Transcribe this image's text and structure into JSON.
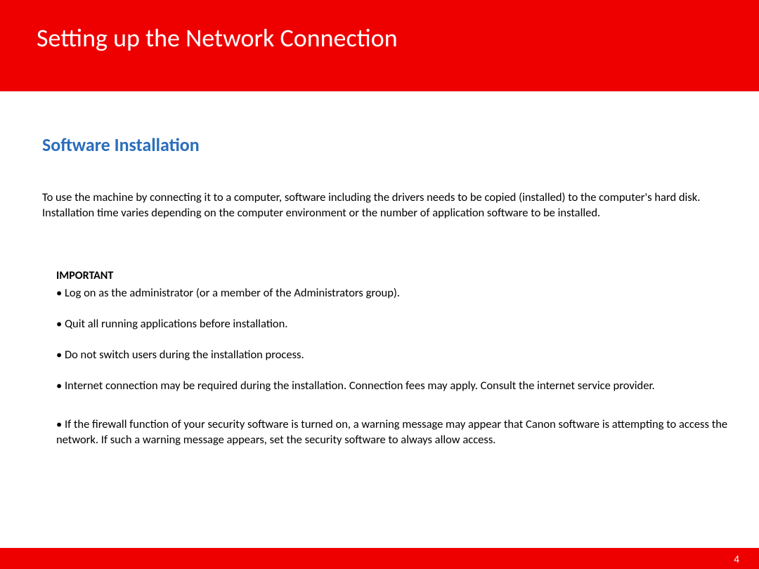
{
  "header": {
    "title": "Setting up the Network Connection"
  },
  "section": {
    "title": "Software Installation",
    "intro": "To use the machine by connecting it to a computer, software including the drivers needs to be copied (installed) to the computer's hard disk. Installation time varies depending on the computer environment or the number of application software to be installed."
  },
  "important": {
    "label": "IMPORTANT",
    "items": [
      "Log on as the administrator (or a member of the Administrators group).",
      "Quit all running applications before installation.",
      "Do not switch users during the installation process.",
      "Internet connection may be required during the installation. Connection fees may apply. Consult the internet service provider.",
      "If the firewall function of your security software is turned on, a warning message may appear that Canon software is attempting to access the network. If such a warning message appears, set the security software to always allow access."
    ]
  },
  "footer": {
    "page_number": "4"
  }
}
